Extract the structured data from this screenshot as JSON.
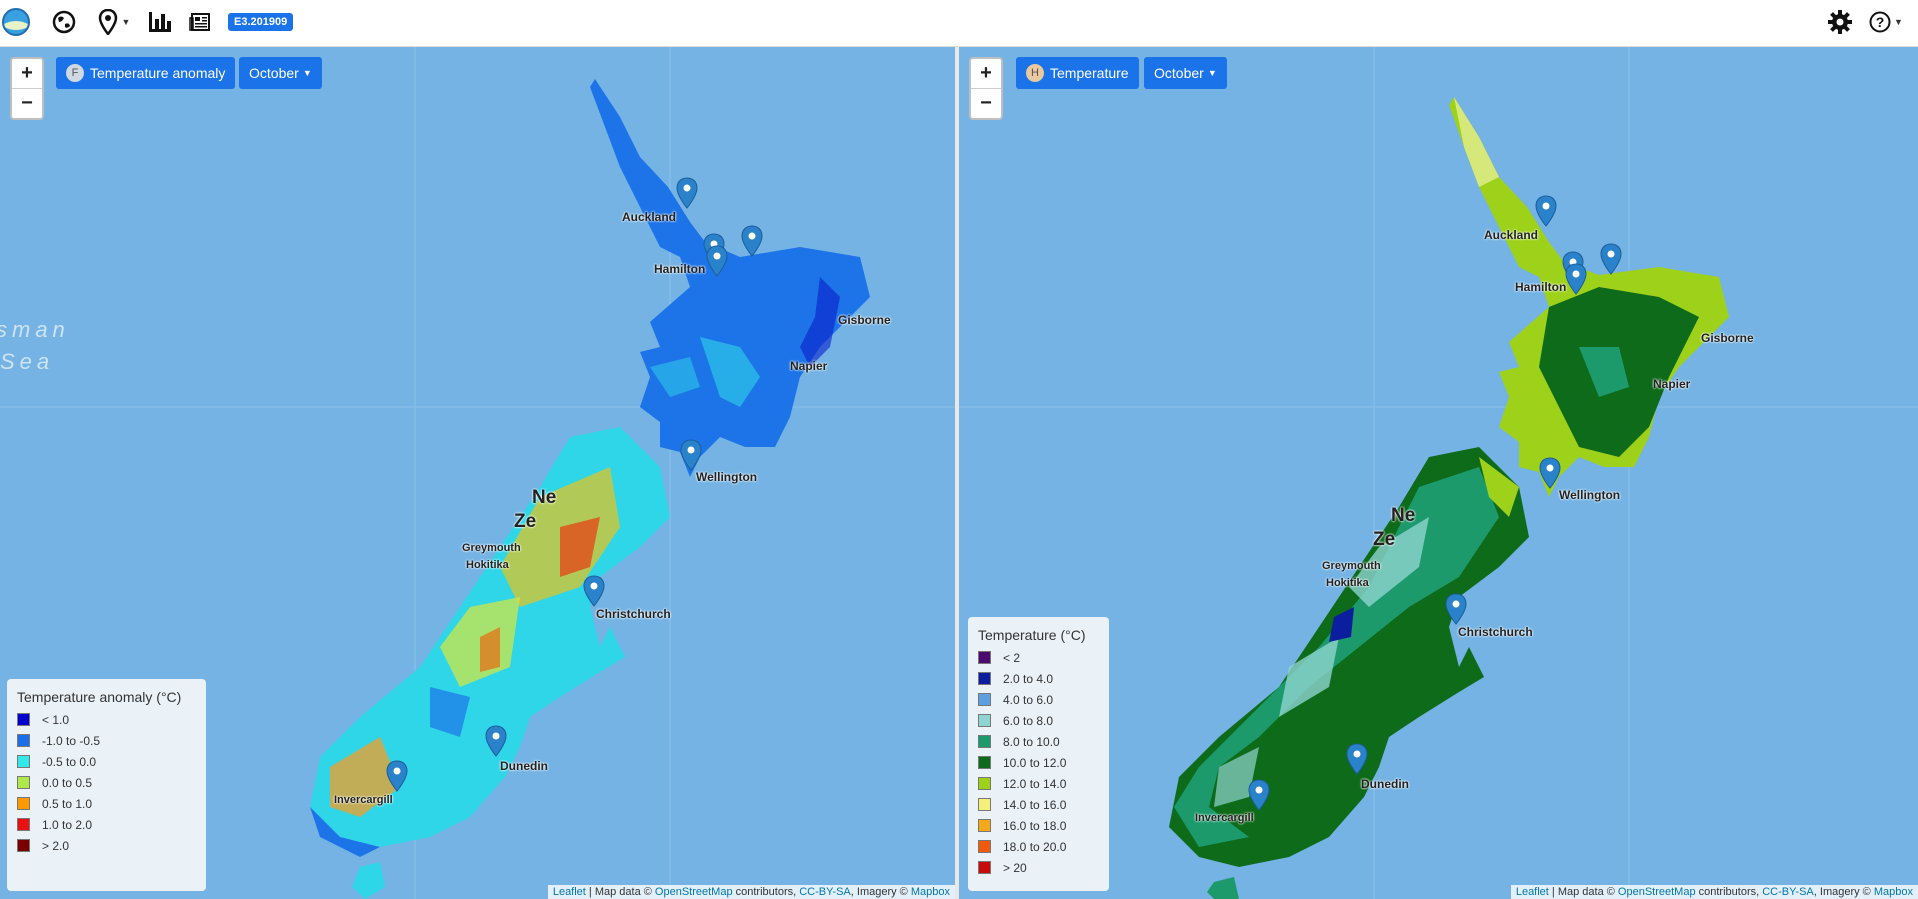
{
  "topbar": {
    "icons": [
      "app-logo-icon",
      "globe-icon",
      "location-pin-icon",
      "bar-chart-icon",
      "newspaper-icon"
    ],
    "version_badge": "E3.201909",
    "right_icons": [
      "gear-icon",
      "help-icon"
    ]
  },
  "left_map": {
    "layer_letter": "F",
    "layer_label": "Temperature anomaly",
    "month_label": "October",
    "zoom_in": "+",
    "zoom_out": "−",
    "sea_label_1": "sman",
    "sea_label_2": "Sea",
    "places": {
      "auckland": "Auckland",
      "hamilton": "Hamilton",
      "gisborne": "Gisborne",
      "napier": "Napier",
      "wellington": "Wellington",
      "new": "Ne",
      "zealand": "Ze",
      "greymouth": "Greymouth",
      "hokitika": "Hokitika",
      "christchurch": "Christchurch",
      "dunedin": "Dunedin",
      "invercargill": "Invercargill"
    },
    "legend": {
      "title": "Temperature anomaly (°C)",
      "items": [
        {
          "label": "< 1.0",
          "color": "#0000cc"
        },
        {
          "label": "-1.0 to -0.5",
          "color": "#1a6fe8"
        },
        {
          "label": "-0.5 to 0.0",
          "color": "#33e8e8"
        },
        {
          "label": "0.0 to 0.5",
          "color": "#aee84a"
        },
        {
          "label": "0.5 to 1.0",
          "color": "#ff9900"
        },
        {
          "label": "1.0 to 2.0",
          "color": "#e81010"
        },
        {
          "label": "> 2.0",
          "color": "#7a0000"
        }
      ]
    }
  },
  "right_map": {
    "layer_letter": "H",
    "layer_label": "Temperature",
    "month_label": "October",
    "zoom_in": "+",
    "zoom_out": "−",
    "places": {
      "auckland": "Auckland",
      "hamilton": "Hamilton",
      "gisborne": "Gisborne",
      "napier": "Napier",
      "wellington": "Wellington",
      "new": "Ne",
      "zealand": "Ze",
      "greymouth": "Greymouth",
      "hokitika": "Hokitika",
      "christchurch": "Christchurch",
      "dunedin": "Dunedin",
      "invercargill": "Invercargill"
    },
    "legend": {
      "title": "Temperature (°C)",
      "items": [
        {
          "label": "< 2",
          "color": "#4b0a6e"
        },
        {
          "label": "2.0 to 4.0",
          "color": "#0a1e9e"
        },
        {
          "label": "4.0 to 6.0",
          "color": "#5e9fe0"
        },
        {
          "label": "6.0 to 8.0",
          "color": "#8fd4d0"
        },
        {
          "label": "8.0 to 10.0",
          "color": "#1d9a6c"
        },
        {
          "label": "10.0 to 12.0",
          "color": "#0e6b1a"
        },
        {
          "label": "12.0 to 14.0",
          "color": "#9ed11a"
        },
        {
          "label": "14.0 to 16.0",
          "color": "#f5f07a"
        },
        {
          "label": "16.0 to 18.0",
          "color": "#f5a81a"
        },
        {
          "label": "18.0 to 20.0",
          "color": "#f05a0a"
        },
        {
          "label": "> 20",
          "color": "#c80a0a"
        }
      ]
    }
  },
  "attribution": {
    "leaflet": "Leaflet",
    "sep": " | Map data © ",
    "osm": "OpenStreetMap",
    "contrib": " contributors, ",
    "ccbysa": "CC-BY-SA",
    "imagery": ", Imagery © ",
    "mapbox": "Mapbox"
  },
  "colors": {
    "accent": "#1a73e8",
    "sea": "#74b3e3"
  }
}
